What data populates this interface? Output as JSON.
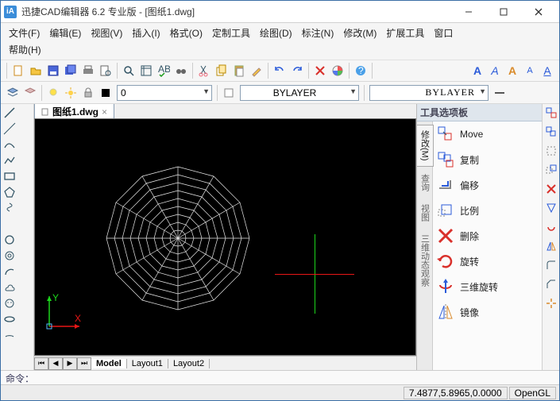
{
  "app": {
    "title": "迅捷CAD编辑器 6.2 专业版  - [图纸1.dwg]"
  },
  "menu": {
    "items": [
      "文件(F)",
      "编辑(E)",
      "视图(V)",
      "插入(I)",
      "格式(O)",
      "定制工具",
      "绘图(D)",
      "标注(N)",
      "修改(M)",
      "扩展工具",
      "窗口",
      "帮助(H)"
    ]
  },
  "layer_combo": {
    "value": "0"
  },
  "style_combo1": {
    "value": "BYLAYER"
  },
  "style_combo2": {
    "value": "BYLAYER"
  },
  "doctab": {
    "name": "图纸1.dwg"
  },
  "palette": {
    "title": "工具选项板",
    "side_tabs": [
      "修改(M)",
      "查询",
      "视图",
      "三维动态观察"
    ],
    "items": [
      {
        "label": "Move"
      },
      {
        "label": "复制"
      },
      {
        "label": "偏移"
      },
      {
        "label": "比例"
      },
      {
        "label": "删除"
      },
      {
        "label": "旋转"
      },
      {
        "label": "三维旋转"
      },
      {
        "label": "镜像"
      }
    ]
  },
  "model_tabs": {
    "model": "Model",
    "layout1": "Layout1",
    "layout2": "Layout2"
  },
  "cmd": {
    "label": "命令："
  },
  "status": {
    "coords": "7.4877,5.8965,0.0000",
    "render": "OpenGL"
  },
  "text_style": {
    "a": "A"
  }
}
